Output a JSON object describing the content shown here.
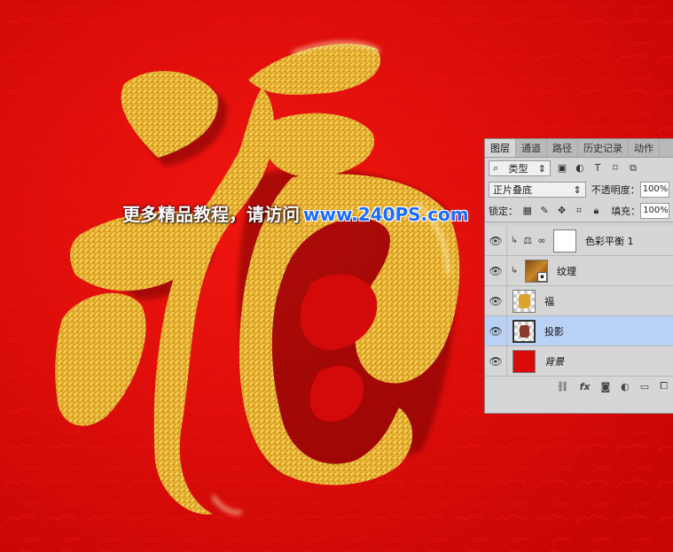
{
  "watermark": {
    "text": "更多精品教程，请访问",
    "url": "www.240PS.com"
  },
  "panel": {
    "tabs": [
      {
        "label": "图层",
        "active": true
      },
      {
        "label": "通道"
      },
      {
        "label": "路径"
      },
      {
        "label": "历史记录"
      },
      {
        "label": "动作"
      }
    ],
    "filter_kind": "类型",
    "blend_mode": "正片叠底",
    "opacity_label": "不透明度：",
    "opacity_value": "100%",
    "lock_label": "锁定：",
    "fill_label": "填充：",
    "fill_value": "100%",
    "layers": [
      {
        "name": "色彩平衡 1",
        "type": "adjustment",
        "clipped": true
      },
      {
        "name": "纹理",
        "type": "texture",
        "clipped": true
      },
      {
        "name": "福",
        "type": "glyph"
      },
      {
        "name": "投影",
        "type": "shadow",
        "selected": true
      },
      {
        "name": "背景",
        "type": "background",
        "italic": true
      }
    ]
  },
  "colors": {
    "background_red": "#d90a0a",
    "gold": "#e6b422",
    "selection_blue": "#b9d1f5",
    "url_blue": "#1e6cff"
  },
  "icons": [
    "search-icon",
    "image-filter-icon",
    "circle-filter-icon",
    "text-filter-icon",
    "transform-filter-icon",
    "smart-filter-icon",
    "eye-icon",
    "clip-arrow-icon",
    "balance-icon",
    "chain-icon",
    "link-icon",
    "fx-icon",
    "mask-icon",
    "adjustment-icon",
    "folder-icon",
    "new-layer-icon",
    "trash-icon"
  ]
}
